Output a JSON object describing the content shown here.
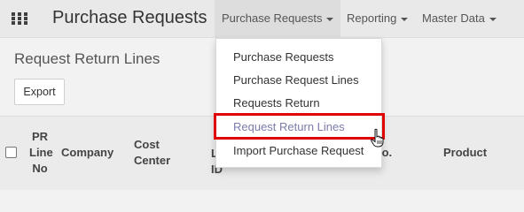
{
  "navbar": {
    "app_title": "Purchase Requests",
    "menus": [
      {
        "label": "Purchase Requests"
      },
      {
        "label": "Reporting"
      },
      {
        "label": "Master Data"
      }
    ]
  },
  "page": {
    "title": "Request Return Lines",
    "export_label": "Export"
  },
  "table": {
    "headers": {
      "pr_line_no": [
        "PR",
        "Line",
        "No"
      ],
      "company": "Company",
      "cost_center": [
        "Cost",
        "Center"
      ],
      "hidden_col": [
        "L",
        "ID"
      ],
      "line_no_suffix": "lo.",
      "product": "Product"
    }
  },
  "dropdown": {
    "items": [
      {
        "label": "Purchase Requests"
      },
      {
        "label": "Purchase Request Lines"
      },
      {
        "label": "Requests Return"
      },
      {
        "label": "Request Return Lines"
      },
      {
        "label": "Import Purchase Request"
      }
    ],
    "highlight_color": "#e00000",
    "active_color": "#7c7bad"
  },
  "icons": [
    "apps-grid-icon",
    "caret-down-icon",
    "checkbox",
    "hand-pointer-cursor-icon"
  ]
}
